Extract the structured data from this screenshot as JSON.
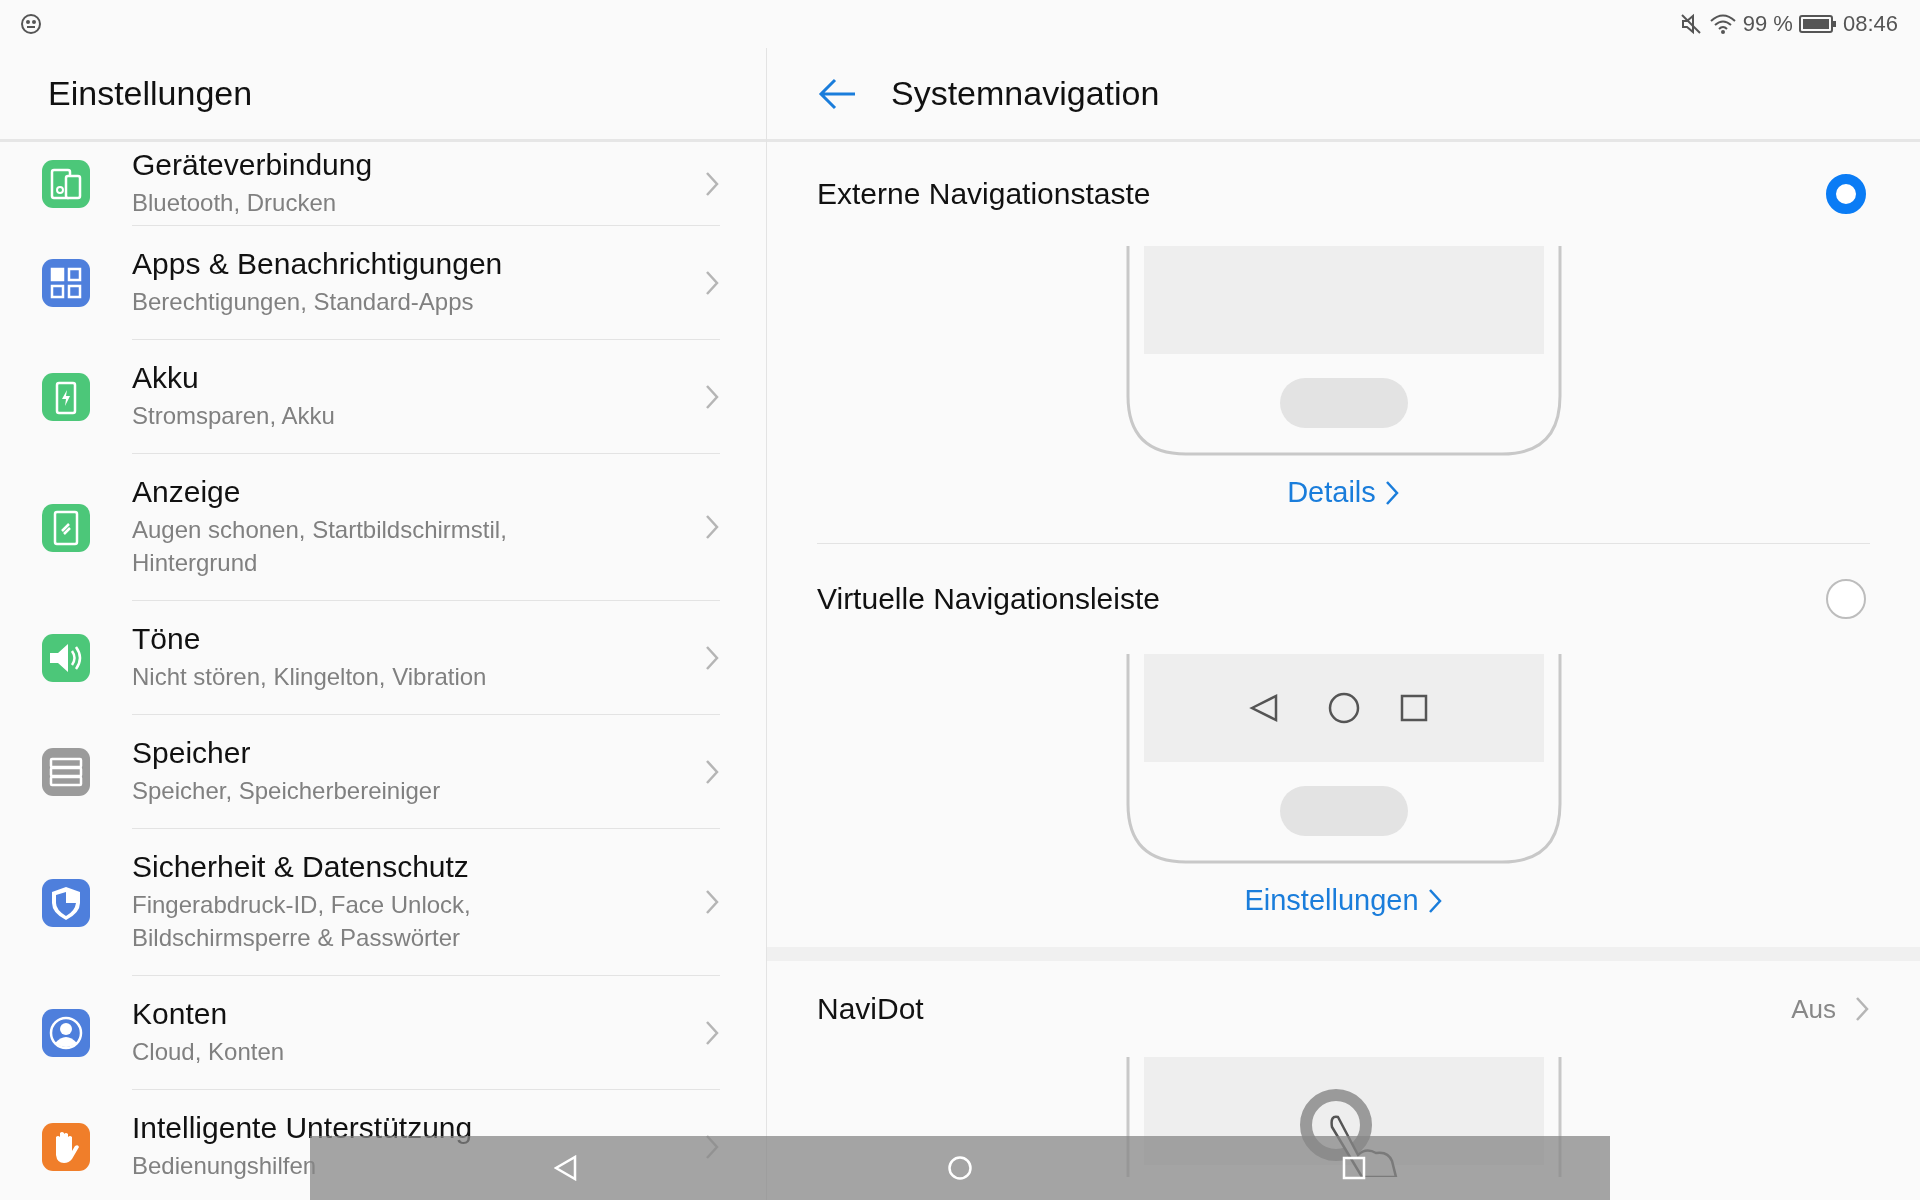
{
  "status_bar": {
    "battery": "99 %",
    "time": "08:46"
  },
  "sidebar": {
    "title": "Einstellungen",
    "items": [
      {
        "title": "Geräteverbindung",
        "subtitle": "Bluetooth, Drucken",
        "color": "#4cc779"
      },
      {
        "title": "Apps & Benachrichtigungen",
        "subtitle": "Berechtigungen, Standard-Apps",
        "color": "#4e7fdc"
      },
      {
        "title": "Akku",
        "subtitle": "Stromsparen, Akku",
        "color": "#4cc779"
      },
      {
        "title": "Anzeige",
        "subtitle": "Augen schonen, Startbildschirmstil, Hintergrund",
        "color": "#4cc779"
      },
      {
        "title": "Töne",
        "subtitle": "Nicht stören, Klingelton, Vibration",
        "color": "#4cc779"
      },
      {
        "title": "Speicher",
        "subtitle": "Speicher, Speicherbereiniger",
        "color": "#9b9b9b"
      },
      {
        "title": "Sicherheit & Datenschutz",
        "subtitle": "Fingerabdruck-ID, Face Unlock, Bildschirmsperre & Passwörter",
        "color": "#4e7fdc"
      },
      {
        "title": "Konten",
        "subtitle": "Cloud, Konten",
        "color": "#4e7fdc"
      },
      {
        "title": "Intelligente Unterstützung",
        "subtitle": "Bedienungshilfen",
        "color": "#f07e2a"
      }
    ]
  },
  "detail": {
    "title": "Systemnavigation",
    "options": [
      {
        "label": "Externe Navigationstaste",
        "selected": true,
        "link": "Details",
        "kind": "button"
      },
      {
        "label": "Virtuelle Navigationsleiste",
        "selected": false,
        "link": "Einstellungen",
        "kind": "bar"
      }
    ],
    "navidot": {
      "label": "NaviDot",
      "value": "Aus"
    }
  }
}
